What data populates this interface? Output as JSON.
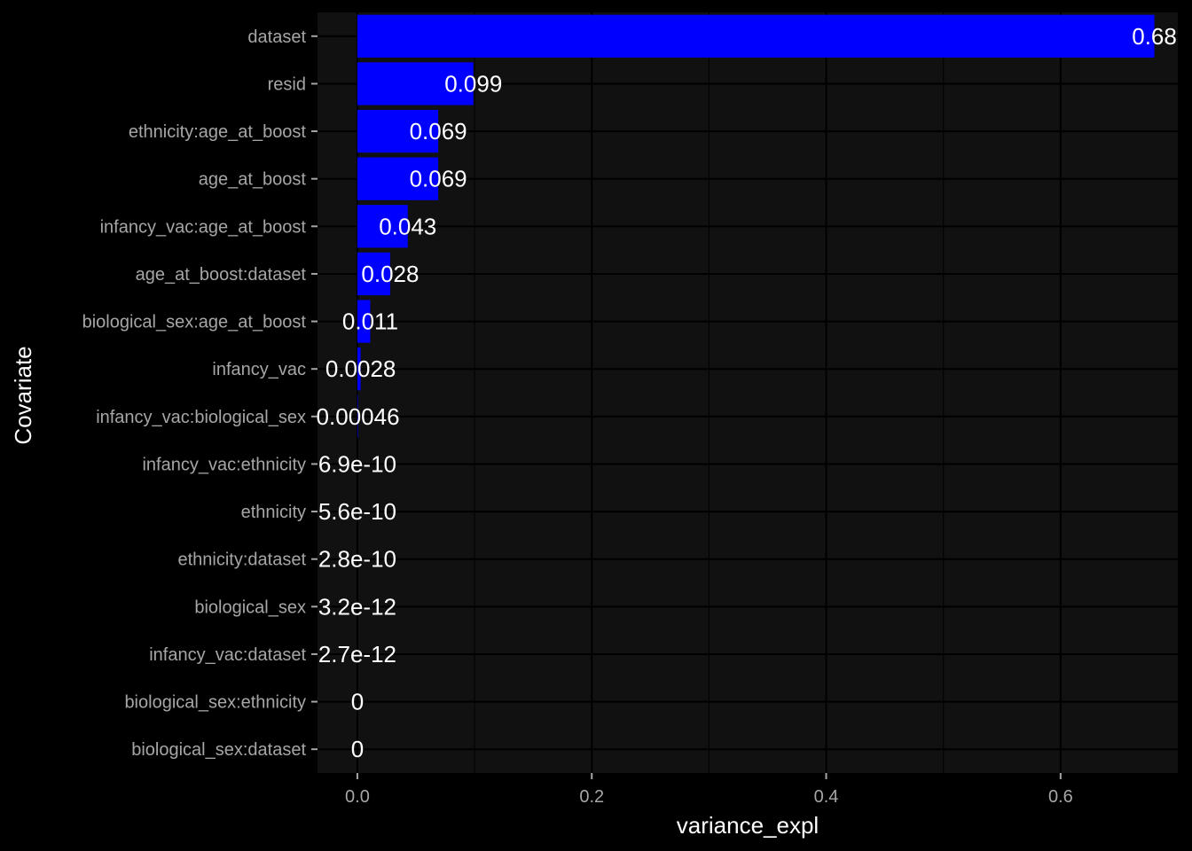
{
  "chart_data": {
    "type": "bar",
    "orientation": "horizontal",
    "xlabel": "variance_expl",
    "ylabel": "Covariate",
    "xlim": [
      -0.034,
      0.7
    ],
    "x_ticks": [
      0.0,
      0.2,
      0.4,
      0.6
    ],
    "x_tick_labels": [
      "0.0",
      "0.2",
      "0.4",
      "0.6"
    ],
    "grid": true,
    "colors": {
      "bar": "#0000FF",
      "panel": "#111111",
      "background": "#000000",
      "grid": "#000000",
      "tick_text": "#A6A6A6",
      "title_text": "#FFFFFF",
      "label_text": "#FFFFFF"
    },
    "categories": [
      "dataset",
      "resid",
      "ethnicity:age_at_boost",
      "age_at_boost",
      "infancy_vac:age_at_boost",
      "age_at_boost:dataset",
      "biological_sex:age_at_boost",
      "infancy_vac",
      "infancy_vac:biological_sex",
      "infancy_vac:ethnicity",
      "ethnicity",
      "ethnicity:dataset",
      "biological_sex",
      "infancy_vac:dataset",
      "biological_sex:ethnicity",
      "biological_sex:dataset"
    ],
    "values": [
      0.68,
      0.099,
      0.069,
      0.069,
      0.043,
      0.028,
      0.011,
      0.0028,
      0.00046,
      6.9e-10,
      5.6e-10,
      2.8e-10,
      3.2e-12,
      2.7e-12,
      0,
      0
    ],
    "labels": [
      "0.68",
      "0.099",
      "0.069",
      "0.069",
      "0.043",
      "0.028",
      "0.011",
      "0.0028",
      "0.00046",
      "6.9e-10",
      "5.6e-10",
      "2.8e-10",
      "3.2e-12",
      "2.7e-12",
      "0",
      "0"
    ]
  }
}
